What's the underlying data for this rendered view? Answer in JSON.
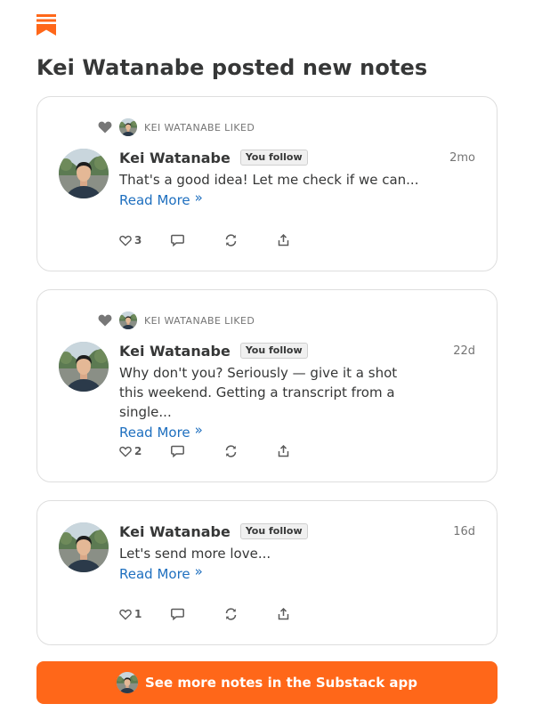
{
  "brand": {
    "accent": "#ff6719",
    "link": "#1e6fbf",
    "logo_icon": "substack-logo-icon"
  },
  "page": {
    "title": "Kei Watanabe posted new notes"
  },
  "notes": [
    {
      "liked_by": "KEI WATANABE LIKED",
      "author": "Kei Watanabe",
      "badge": "You follow",
      "time": "2mo",
      "text": "That's a good idea! Let me check if we can...",
      "read_more": "Read More",
      "likes": "3"
    },
    {
      "liked_by": "KEI WATANABE LIKED",
      "author": "Kei Watanabe",
      "badge": "You follow",
      "time": "22d",
      "text": "Why don't you? Seriously — give it a shot this weekend. Getting a transcript from a single...",
      "read_more": "Read More",
      "likes": "2"
    },
    {
      "author": "Kei Watanabe",
      "badge": "You follow",
      "time": "16d",
      "text": "Let's send more love...",
      "read_more": "Read More",
      "likes": "1"
    }
  ],
  "cta": {
    "label": "See more notes in the Substack app"
  }
}
